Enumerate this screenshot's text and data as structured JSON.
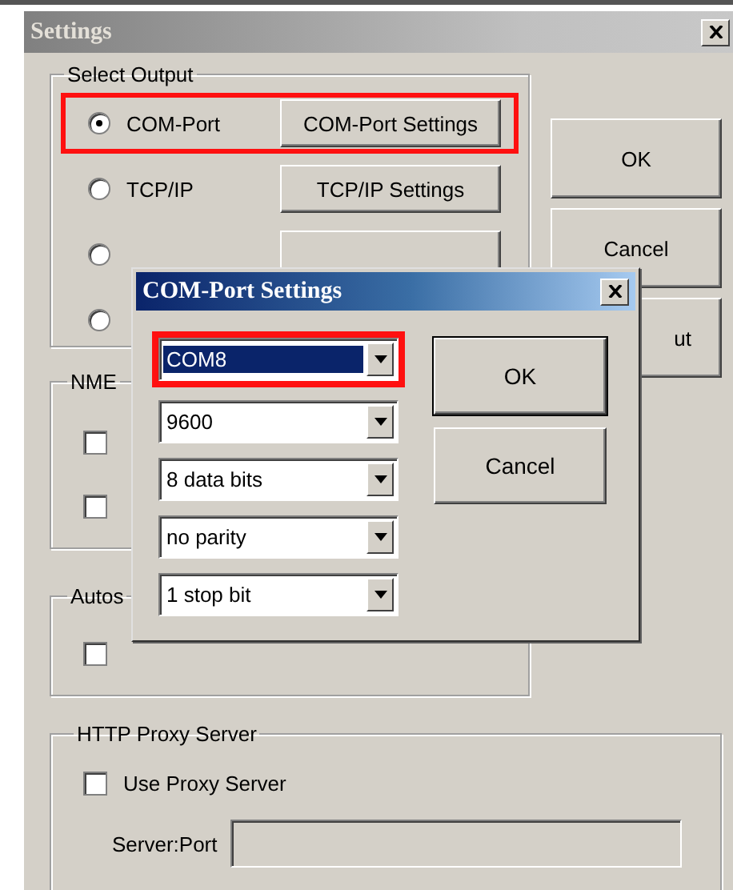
{
  "window": {
    "title": "Settings"
  },
  "select_output": {
    "label": "Select Output",
    "options": [
      {
        "label": "COM-Port",
        "selected": true,
        "highlighted": true,
        "button": "COM-Port Settings"
      },
      {
        "label": "TCP/IP",
        "selected": false,
        "highlighted": false,
        "button": "TCP/IP Settings"
      },
      {
        "selected": false,
        "highlighted": false,
        "kind": "covered_button"
      },
      {
        "selected": false,
        "highlighted": false
      }
    ]
  },
  "side_buttons": [
    {
      "label": "OK"
    },
    {
      "label": "Cancel"
    },
    {
      "label": "ut",
      "kind": "covered"
    }
  ],
  "nmea": {
    "label": "NME",
    "checkboxes": [
      {
        "checked": false
      },
      {
        "checked": false
      }
    ]
  },
  "autostart": {
    "label": "Autos",
    "checkboxes": [
      {
        "checked": false
      }
    ]
  },
  "http_proxy": {
    "label": "HTTP Proxy Server",
    "checkbox": {
      "label": "Use Proxy Server",
      "checked": false
    },
    "server_port": {
      "label": "Server:Port",
      "disabled": true
    }
  },
  "com_port_dialog": {
    "title": "COM-Port Settings",
    "selects": [
      {
        "value": "COM8",
        "focused": true,
        "highlighted": true
      },
      {
        "value": "9600",
        "focused": false,
        "highlighted": false
      },
      {
        "value": "8 data bits",
        "focused": false,
        "highlighted": false
      },
      {
        "value": "no parity",
        "focused": false,
        "highlighted": false
      },
      {
        "value": "1 stop bit",
        "focused": false,
        "highlighted": false
      }
    ],
    "buttons": [
      {
        "label": "OK",
        "default": true
      },
      {
        "label": "Cancel",
        "default": false
      }
    ]
  }
}
